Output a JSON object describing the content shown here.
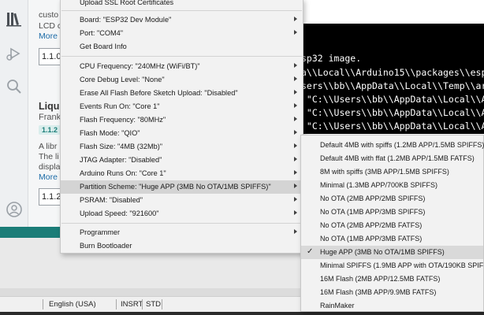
{
  "library_panel": {
    "prev_desc_1": "custo",
    "prev_desc_2": "LCD c",
    "prev_more": "More",
    "prev_version": "1.1.0",
    "lib_title": "Liqu",
    "lib_author": "Frank",
    "lib_badge": "1.1.2",
    "lib_desc_1": "A libr",
    "lib_desc_2": "The li",
    "lib_desc_3": "displa",
    "lib_more": "More",
    "lib_version": "1.1.2"
  },
  "console": {
    "lines": [
      "sp32 image.",
      "a\\\\Local\\\\Arduino15\\\\packages\\\\esp32",
      "sers\\\\bb\\\\AppData\\\\Local\\\\Temp\\\\ardu",
      " \"C:\\\\Users\\\\bb\\\\AppData\\\\Local\\\\Ard",
      " \"C:\\\\Users\\\\bb\\\\AppData\\\\Local\\\\Ard",
      " \"C:\\\\Users\\\\bb\\\\AppData\\\\Local\\\\Ard"
    ]
  },
  "menu": {
    "upload_ssl": "Upload SSL Root Certificates",
    "board": "Board: \"ESP32 Dev Module\"",
    "port": "Port: \"COM4\"",
    "get_board_info": "Get Board Info",
    "cpu_frequency": "CPU Frequency: \"240MHz (WiFi/BT)\"",
    "core_debug_level": "Core Debug Level: \"None\"",
    "erase_flash": "Erase All Flash Before Sketch Upload: \"Disabled\"",
    "events_run_on": "Events Run On: \"Core 1\"",
    "flash_frequency": "Flash Frequency: \"80MHz\"",
    "flash_mode": "Flash Mode: \"QIO\"",
    "flash_size": "Flash Size: \"4MB (32Mb)\"",
    "jtag_adapter": "JTAG Adapter: \"Disabled\"",
    "arduino_runs_on": "Arduino Runs On: \"Core 1\"",
    "partition_scheme": "Partition Scheme: \"Huge APP (3MB No OTA/1MB SPIFFS)\"",
    "psram": "PSRAM: \"Disabled\"",
    "upload_speed": "Upload Speed: \"921600\"",
    "programmer": "Programmer",
    "burn_bootloader": "Burn Bootloader"
  },
  "partition_submenu": {
    "options": [
      "Default 4MB with spiffs (1.2MB APP/1.5MB SPIFFS)",
      "Default 4MB with ffat (1.2MB APP/1.5MB FATFS)",
      "8M with spiffs (3MB APP/1.5MB SPIFFS)",
      "Minimal (1.3MB APP/700KB SPIFFS)",
      "No OTA (2MB APP/2MB SPIFFS)",
      "No OTA (1MB APP/3MB SPIFFS)",
      "No OTA (2MB APP/2MB FATFS)",
      "No OTA (1MB APP/3MB FATFS)",
      "Huge APP (3MB No OTA/1MB SPIFFS)",
      "Minimal SPIFFS (1.9MB APP with OTA/190KB SPIFFS)",
      "16M Flash (2MB APP/12.5MB FATFS)",
      "16M Flash (3MB APP/9.9MB FATFS)",
      "RainMaker"
    ],
    "selected_index": 8
  },
  "status_bar": {
    "language": "English (USA)",
    "insert_mode": "INSRT",
    "std": "STD"
  },
  "colors": {
    "accent_teal": "#1b7d78",
    "console_bg": "#000000",
    "menu_bg": "#f2f2f2",
    "menu_highlight": "#d4d4d4"
  },
  "icons": [
    "library-icon",
    "debug-icon",
    "search-icon",
    "account-icon",
    "check-icon",
    "chevron-right-icon"
  ]
}
